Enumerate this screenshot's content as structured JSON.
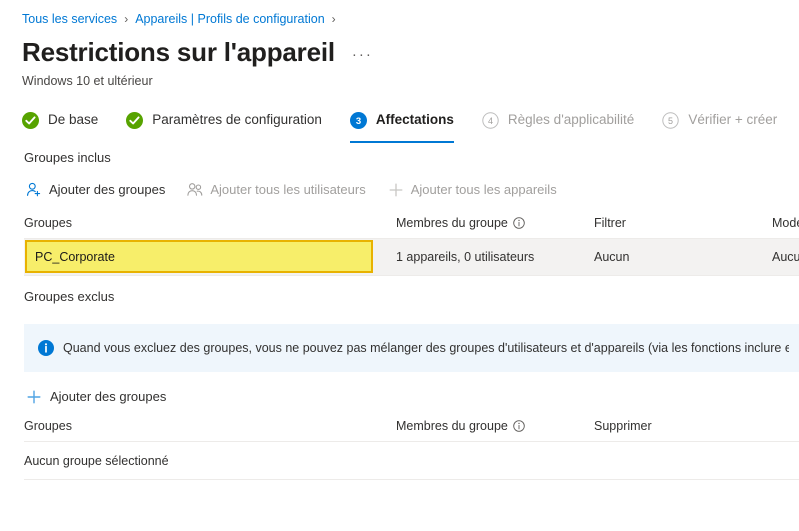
{
  "breadcrumb": {
    "items": [
      {
        "label": "Tous les services"
      },
      {
        "label": "Appareils | Profils de configuration"
      }
    ],
    "separator": "›"
  },
  "header": {
    "title": "Restrictions sur l'appareil",
    "more_label": "···",
    "subtitle": "Windows 10 et ultérieur"
  },
  "wizard": {
    "steps": [
      {
        "label": "De base",
        "state": "complete",
        "icon": "check-circle-icon",
        "marker": ""
      },
      {
        "label": "Paramètres de configuration",
        "state": "complete",
        "icon": "check-circle-icon",
        "marker": ""
      },
      {
        "label": "Affectations",
        "state": "active",
        "icon": "step-number-badge",
        "marker": "3"
      },
      {
        "label": "Règles d'applicabilité",
        "state": "disabled",
        "icon": "step-number-circle",
        "marker": "4"
      },
      {
        "label": "Vérifier + créer",
        "state": "disabled",
        "icon": "step-number-circle",
        "marker": "5"
      }
    ]
  },
  "included": {
    "section_label": "Groupes inclus",
    "commands": [
      {
        "label": "Ajouter des groupes",
        "icon": "person-add-icon",
        "enabled": true
      },
      {
        "label": "Ajouter tous les utilisateurs",
        "icon": "people-icon",
        "enabled": false
      },
      {
        "label": "Ajouter tous les appareils",
        "icon": "plus-icon",
        "enabled": false
      }
    ],
    "columns": [
      {
        "label": "Groupes",
        "has_info": false
      },
      {
        "label": "Membres du groupe",
        "has_info": true
      },
      {
        "label": "Filtrer",
        "has_info": false
      },
      {
        "label": "Mode Filt",
        "has_info": false
      }
    ],
    "rows": [
      {
        "group": "PC_Corporate",
        "members": "1 appareils, 0 utilisateurs",
        "filter": "Aucun",
        "filter_mode": "Aucun",
        "highlighted": true
      }
    ]
  },
  "excluded": {
    "section_label": "Groupes exclus",
    "banner": {
      "icon": "info-circle-icon",
      "text": "Quand vous excluez des groupes, vous ne pouvez pas mélanger des groupes d'utilisateurs et d'appareils (via les fonctions inclure et exclure)"
    },
    "commands": [
      {
        "label": "Ajouter des groupes",
        "icon": "plus-icon",
        "enabled": true
      }
    ],
    "columns": [
      {
        "label": "Groupes",
        "has_info": false
      },
      {
        "label": "Membres du groupe",
        "has_info": true
      },
      {
        "label": "Supprimer",
        "has_info": false
      }
    ],
    "empty_text": "Aucun groupe sélectionné"
  },
  "colors": {
    "accent": "#0078d4",
    "link": "#0078d4",
    "complete_green": "#57a300",
    "highlight_fill": "#f7ee6a",
    "highlight_border": "#e8b200",
    "row_bg": "#f3f2f1",
    "banner_bg": "#eff6fc",
    "disabled_text": "#a19f9d"
  }
}
